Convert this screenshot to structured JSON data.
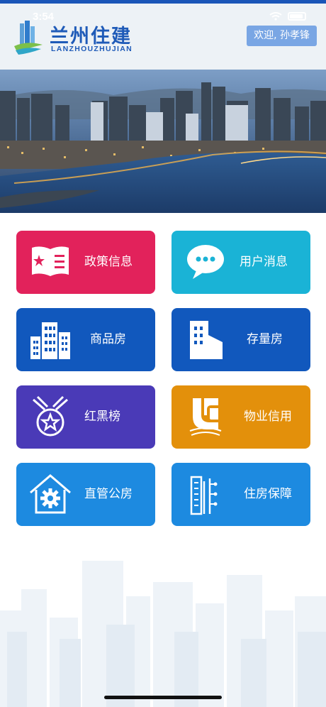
{
  "status": {
    "time": "3:54"
  },
  "header": {
    "brand_title": "兰州住建",
    "brand_subtitle": "LANZHOUZHUJIAN",
    "welcome": "欢迎, 孙孝锋"
  },
  "tiles": [
    {
      "label": "政策信息",
      "color": "#e2225b",
      "icon": "policy-book-icon"
    },
    {
      "label": "用户消息",
      "color": "#1ab3d6",
      "icon": "chat-bubble-icon"
    },
    {
      "label": "商品房",
      "color": "#1158bd",
      "icon": "buildings-icon"
    },
    {
      "label": "存量房",
      "color": "#1158bd",
      "icon": "building-icon"
    },
    {
      "label": "红黑榜",
      "color": "#4a3ab7",
      "icon": "star-medal-icon"
    },
    {
      "label": "物业信用",
      "color": "#e3900b",
      "icon": "property-logo-icon"
    },
    {
      "label": "直管公房",
      "color": "#1d8ae0",
      "icon": "house-gear-icon"
    },
    {
      "label": "住房保障",
      "color": "#1d8ae0",
      "icon": "housing-security-icon"
    }
  ]
}
